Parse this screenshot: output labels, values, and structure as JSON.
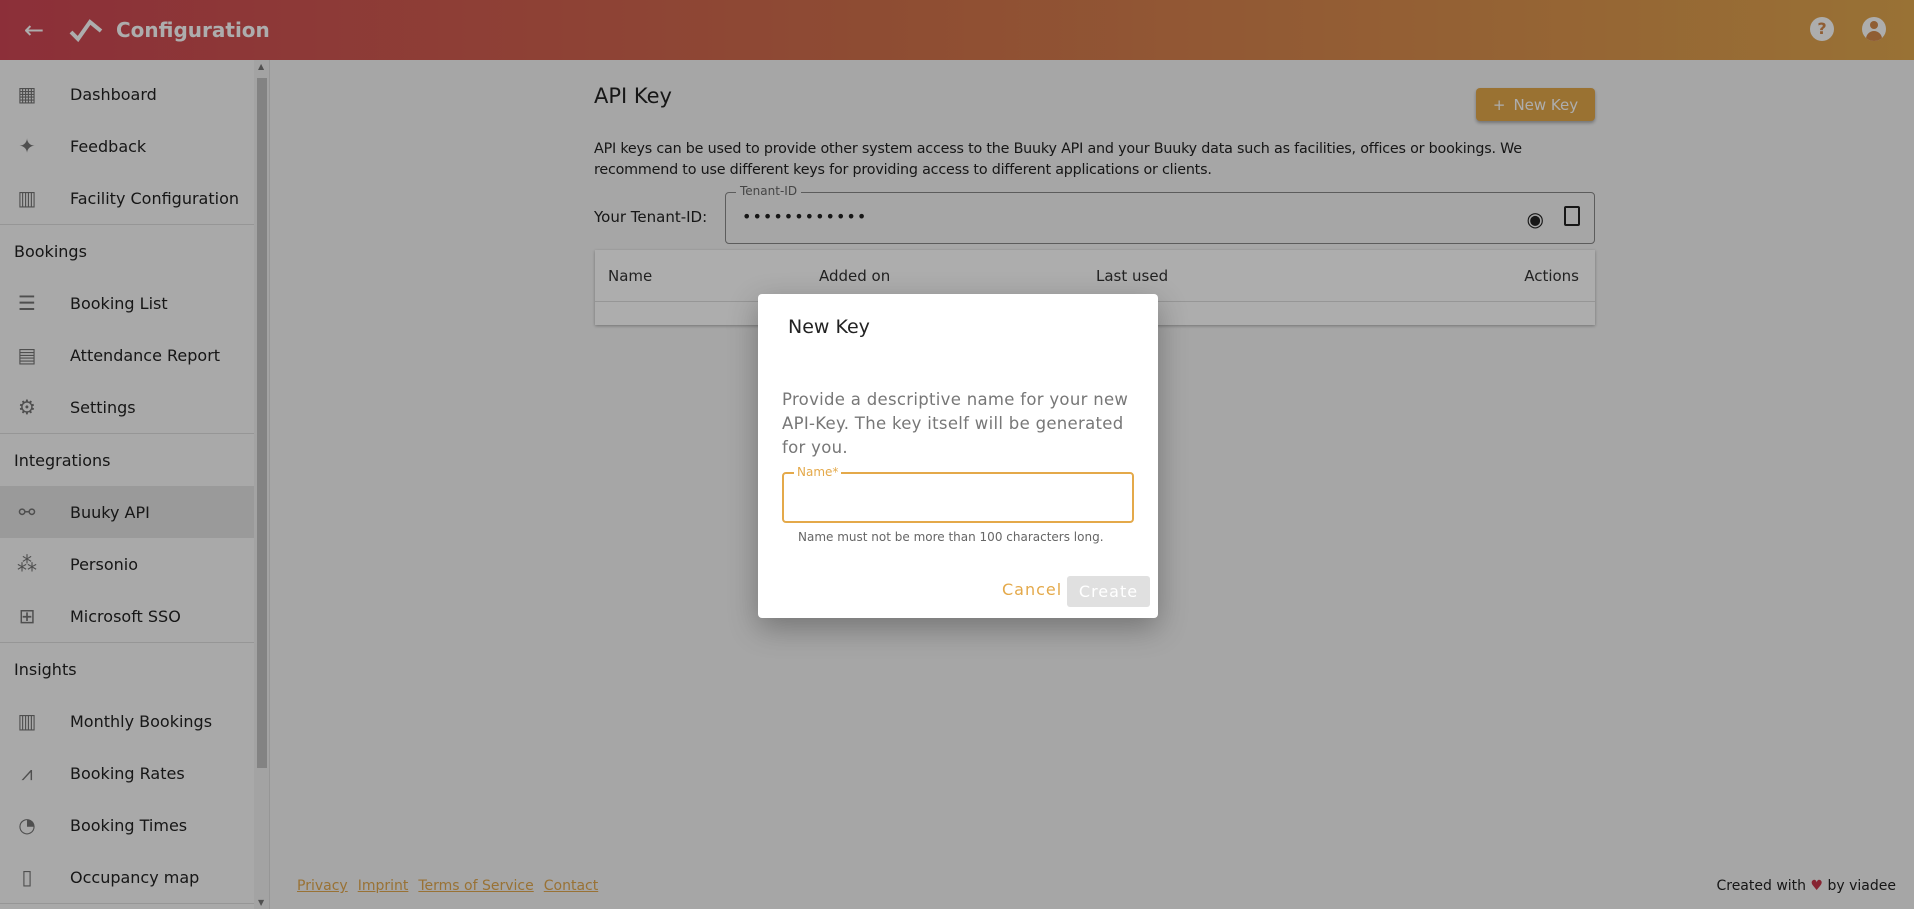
{
  "header": {
    "title": "Configuration",
    "back_icon": "arrow-left-icon",
    "help_icon": "help-circle-icon",
    "account_icon": "account-circle-icon",
    "help_glyph": "?",
    "gradient": [
      "#cf4654",
      "#e2a84e"
    ]
  },
  "sidebar": {
    "items": [
      {
        "label": "Dashboard",
        "icon": "dashboard-icon",
        "glyph": "▦"
      },
      {
        "label": "Feedback",
        "icon": "feedback-icon",
        "glyph": "✦"
      },
      {
        "label": "Facility Configuration",
        "icon": "building-icon",
        "glyph": "▥"
      }
    ],
    "bookings_header": "Bookings",
    "bookings": [
      {
        "label": "Booking List",
        "icon": "list-icon",
        "glyph": "☰"
      },
      {
        "label": "Attendance Report",
        "icon": "report-icon",
        "glyph": "▤"
      },
      {
        "label": "Settings",
        "icon": "gear-icon",
        "glyph": "⚙"
      }
    ],
    "integrations_header": "Integrations",
    "integrations": [
      {
        "label": "Buuky API",
        "icon": "webhook-icon",
        "glyph": "⚯",
        "active": true
      },
      {
        "label": "Personio",
        "icon": "people-icon",
        "glyph": "⁂"
      },
      {
        "label": "Microsoft SSO",
        "icon": "windows-icon",
        "glyph": "⊞"
      }
    ],
    "insights_header": "Insights",
    "insights": [
      {
        "label": "Monthly Bookings",
        "icon": "table-icon",
        "glyph": "▥"
      },
      {
        "label": "Booking Rates",
        "icon": "chart-line-icon",
        "glyph": "⩘"
      },
      {
        "label": "Booking Times",
        "icon": "clock-icon",
        "glyph": "◔"
      },
      {
        "label": "Occupancy map",
        "icon": "map-icon",
        "glyph": "▯"
      }
    ]
  },
  "main": {
    "title": "API Key",
    "new_key_label": "New Key",
    "new_key_glyph": "+",
    "description": "API keys can be used to provide other system access to the Buuky API and your Buuky data such as facilities, offices or bookings. We recommend to use different keys for providing access to different applications or clients.",
    "tenant_label": "Your Tenant-ID:",
    "tenant_field_label": "Tenant-ID",
    "tenant_value": "••••••••••••",
    "eye_glyph": "◉",
    "table_headers": [
      "Name",
      "Added on",
      "Last used",
      "Actions"
    ]
  },
  "footer": {
    "links": [
      "Privacy",
      "Imprint",
      "Terms of Service",
      "Contact"
    ],
    "credit_prefix": "Created with",
    "heart": "♥",
    "credit_suffix": "by viadee"
  },
  "dialog": {
    "title": "New Key",
    "text": "Provide a descriptive name for your new API-Key. The key itself will be generated for you.",
    "field_label": "Name*",
    "field_value": "",
    "hint": "Name must not be more than 100 characters long.",
    "cancel_label": "Cancel",
    "create_label": "Create",
    "accent": "#e4a94a"
  }
}
